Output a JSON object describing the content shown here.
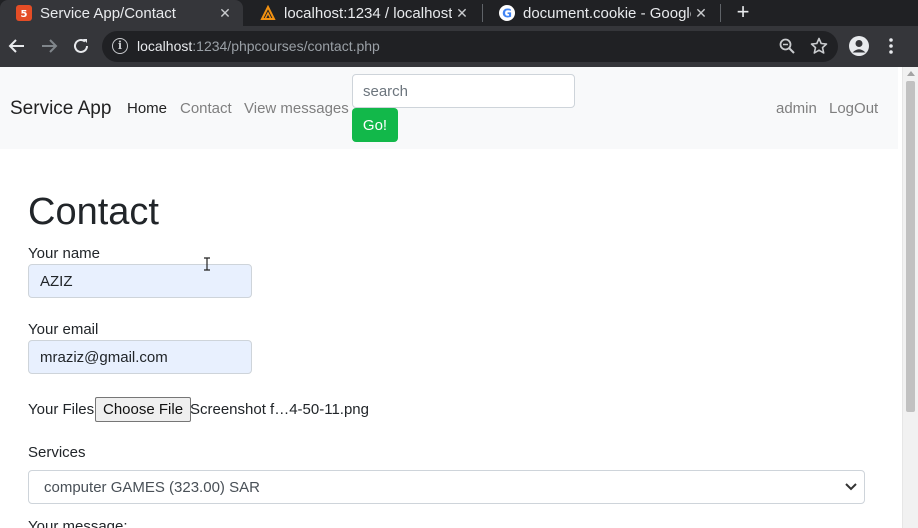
{
  "browser": {
    "tabs": [
      {
        "title": "Service App/Contact",
        "active": true,
        "favicon": "html5-icon",
        "favicon_color": "#e44d26"
      },
      {
        "title": "localhost:1234 / localhost",
        "active": false,
        "favicon": "phpmyadmin-icon",
        "favicon_color": "#f29111"
      },
      {
        "title": "document.cookie - Google",
        "active": false,
        "favicon": "google-icon",
        "favicon_color": "#4285f4"
      }
    ],
    "address": {
      "host": "localhost",
      "rest": ":1234/phpcourses/contact.php"
    }
  },
  "navbar": {
    "brand": "Service App",
    "links": [
      "Home",
      "Contact",
      "View messages"
    ],
    "search_placeholder": "search",
    "go_label": "Go!",
    "right_links": [
      "admin",
      "LogOut"
    ],
    "go_color": "#12b84a"
  },
  "form": {
    "title": "Contact",
    "name_label": "Your name",
    "name_value": "AZIZ",
    "email_label": "Your email",
    "email_value": "mraziz@gmail.com",
    "files_label": "Your Files",
    "file_button": "Choose File",
    "file_name": "Screenshot f…4-50-11.png",
    "services_label": "Services",
    "services_selected": "computer GAMES (323.00) SAR",
    "message_label": "Your message:"
  }
}
